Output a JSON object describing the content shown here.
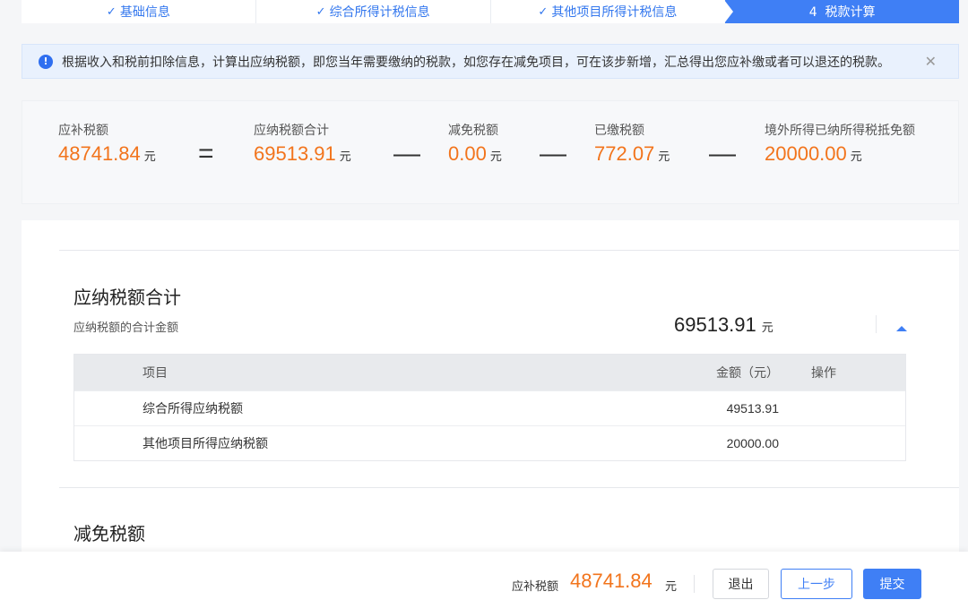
{
  "steps": [
    {
      "label": "基础信息",
      "prefix": "✓"
    },
    {
      "label": "综合所得计税信息",
      "prefix": "✓"
    },
    {
      "label": "其他项目所得计税信息",
      "prefix": "✓"
    },
    {
      "label": "4  税款计算",
      "prefix": ""
    }
  ],
  "alert": {
    "text": "根据收入和税前扣除信息，计算出应纳税额，即您当年需要缴纳的税款，如您存在减免项目，可在该步新增，汇总得出您应补缴或者可以退还的税款。",
    "icon": "info-icon",
    "close": "✕"
  },
  "formula": {
    "unit": "元",
    "items": [
      {
        "label": "应补税额",
        "value": "48741.84"
      },
      {
        "label": "应纳税额合计",
        "value": "69513.91"
      },
      {
        "label": "减免税额",
        "value": "0.00"
      },
      {
        "label": "已缴税额",
        "value": "772.07"
      },
      {
        "label": "境外所得已纳所得税抵免额",
        "value": "20000.00"
      }
    ],
    "operators": [
      "=",
      "—",
      "—",
      "—"
    ]
  },
  "section_tax": {
    "title": "应纳税额合计",
    "subtitle": "应纳税额的合计金额",
    "total": "69513.91",
    "unit": "元",
    "table": {
      "headers": {
        "name": "项目",
        "amount": "金额（元）",
        "op": "操作"
      },
      "rows": [
        {
          "name": "综合所得应纳税额",
          "amount": "49513.91",
          "op": ""
        },
        {
          "name": "其他项目所得应纳税额",
          "amount": "20000.00",
          "op": ""
        }
      ]
    }
  },
  "section_relief": {
    "title": "减免税额"
  },
  "footer": {
    "label": "应补税额",
    "value": "48741.84",
    "unit": "元",
    "exit": "退出",
    "prev": "上一步",
    "submit": "提交"
  },
  "colors": {
    "primary": "#3f7ff5",
    "amount": "#f2741c",
    "alert_bg": "#e9f1fd"
  }
}
